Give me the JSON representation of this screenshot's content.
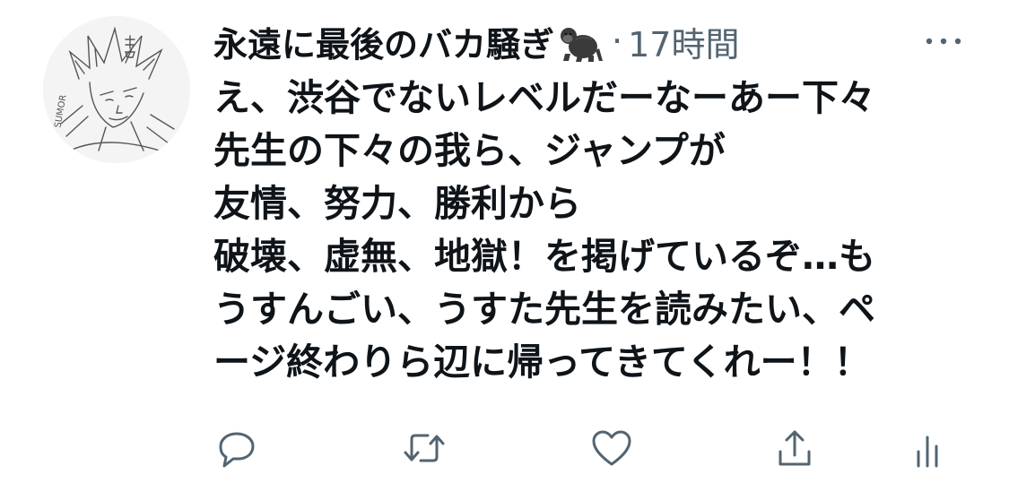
{
  "tweet": {
    "display_name": "永遠に最後のバカ騒ぎ",
    "name_emoji": "gorilla-emoji",
    "separator": "·",
    "time": "17時間",
    "more_icon": "more-horizontal-icon",
    "avatar_icon": "sketch-avatar-icon",
    "text_lines": [
      "え、渋谷でないレベルだーなーあー下々",
      "先生の下々の我ら、ジャンプが",
      "友情、努力、勝利から",
      "破壊、虚無、地獄！を掲げているぞ…も",
      "うすんごい、うすた先生を読みたい、ペ",
      "ージ終わりら辺に帰ってきてくれー！！"
    ]
  },
  "actions": {
    "reply_icon": "reply-icon",
    "retweet_icon": "retweet-icon",
    "like_icon": "heart-icon",
    "share_icon": "share-icon",
    "analytics_icon": "analytics-icon"
  },
  "colors": {
    "text_primary": "#0f1419",
    "text_secondary": "#536471",
    "icon_gray": "#536471",
    "background": "#ffffff"
  }
}
